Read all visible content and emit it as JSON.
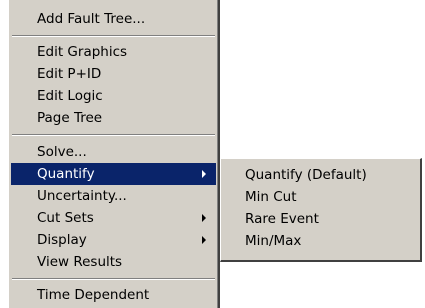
{
  "main_menu": {
    "items": [
      {
        "label": "Add Fault Tree..."
      },
      {
        "label": "Edit Graphics"
      },
      {
        "label": "Edit P+ID"
      },
      {
        "label": "Edit Logic"
      },
      {
        "label": "Page Tree"
      },
      {
        "label": "Solve..."
      },
      {
        "label": "Quantify",
        "has_submenu": true,
        "highlighted": true
      },
      {
        "label": "Uncertainty..."
      },
      {
        "label": "Cut Sets",
        "has_submenu": true
      },
      {
        "label": "Display",
        "has_submenu": true
      },
      {
        "label": "View Results"
      },
      {
        "label": "Time Dependent"
      }
    ]
  },
  "submenu": {
    "items": [
      {
        "label": "Quantify (Default)"
      },
      {
        "label": "Min Cut"
      },
      {
        "label": "Rare Event"
      },
      {
        "label": "Min/Max"
      }
    ]
  },
  "colors": {
    "menu_bg": "#d4d0c8",
    "highlight_bg": "#0a246a",
    "highlight_text": "#ffffff"
  }
}
